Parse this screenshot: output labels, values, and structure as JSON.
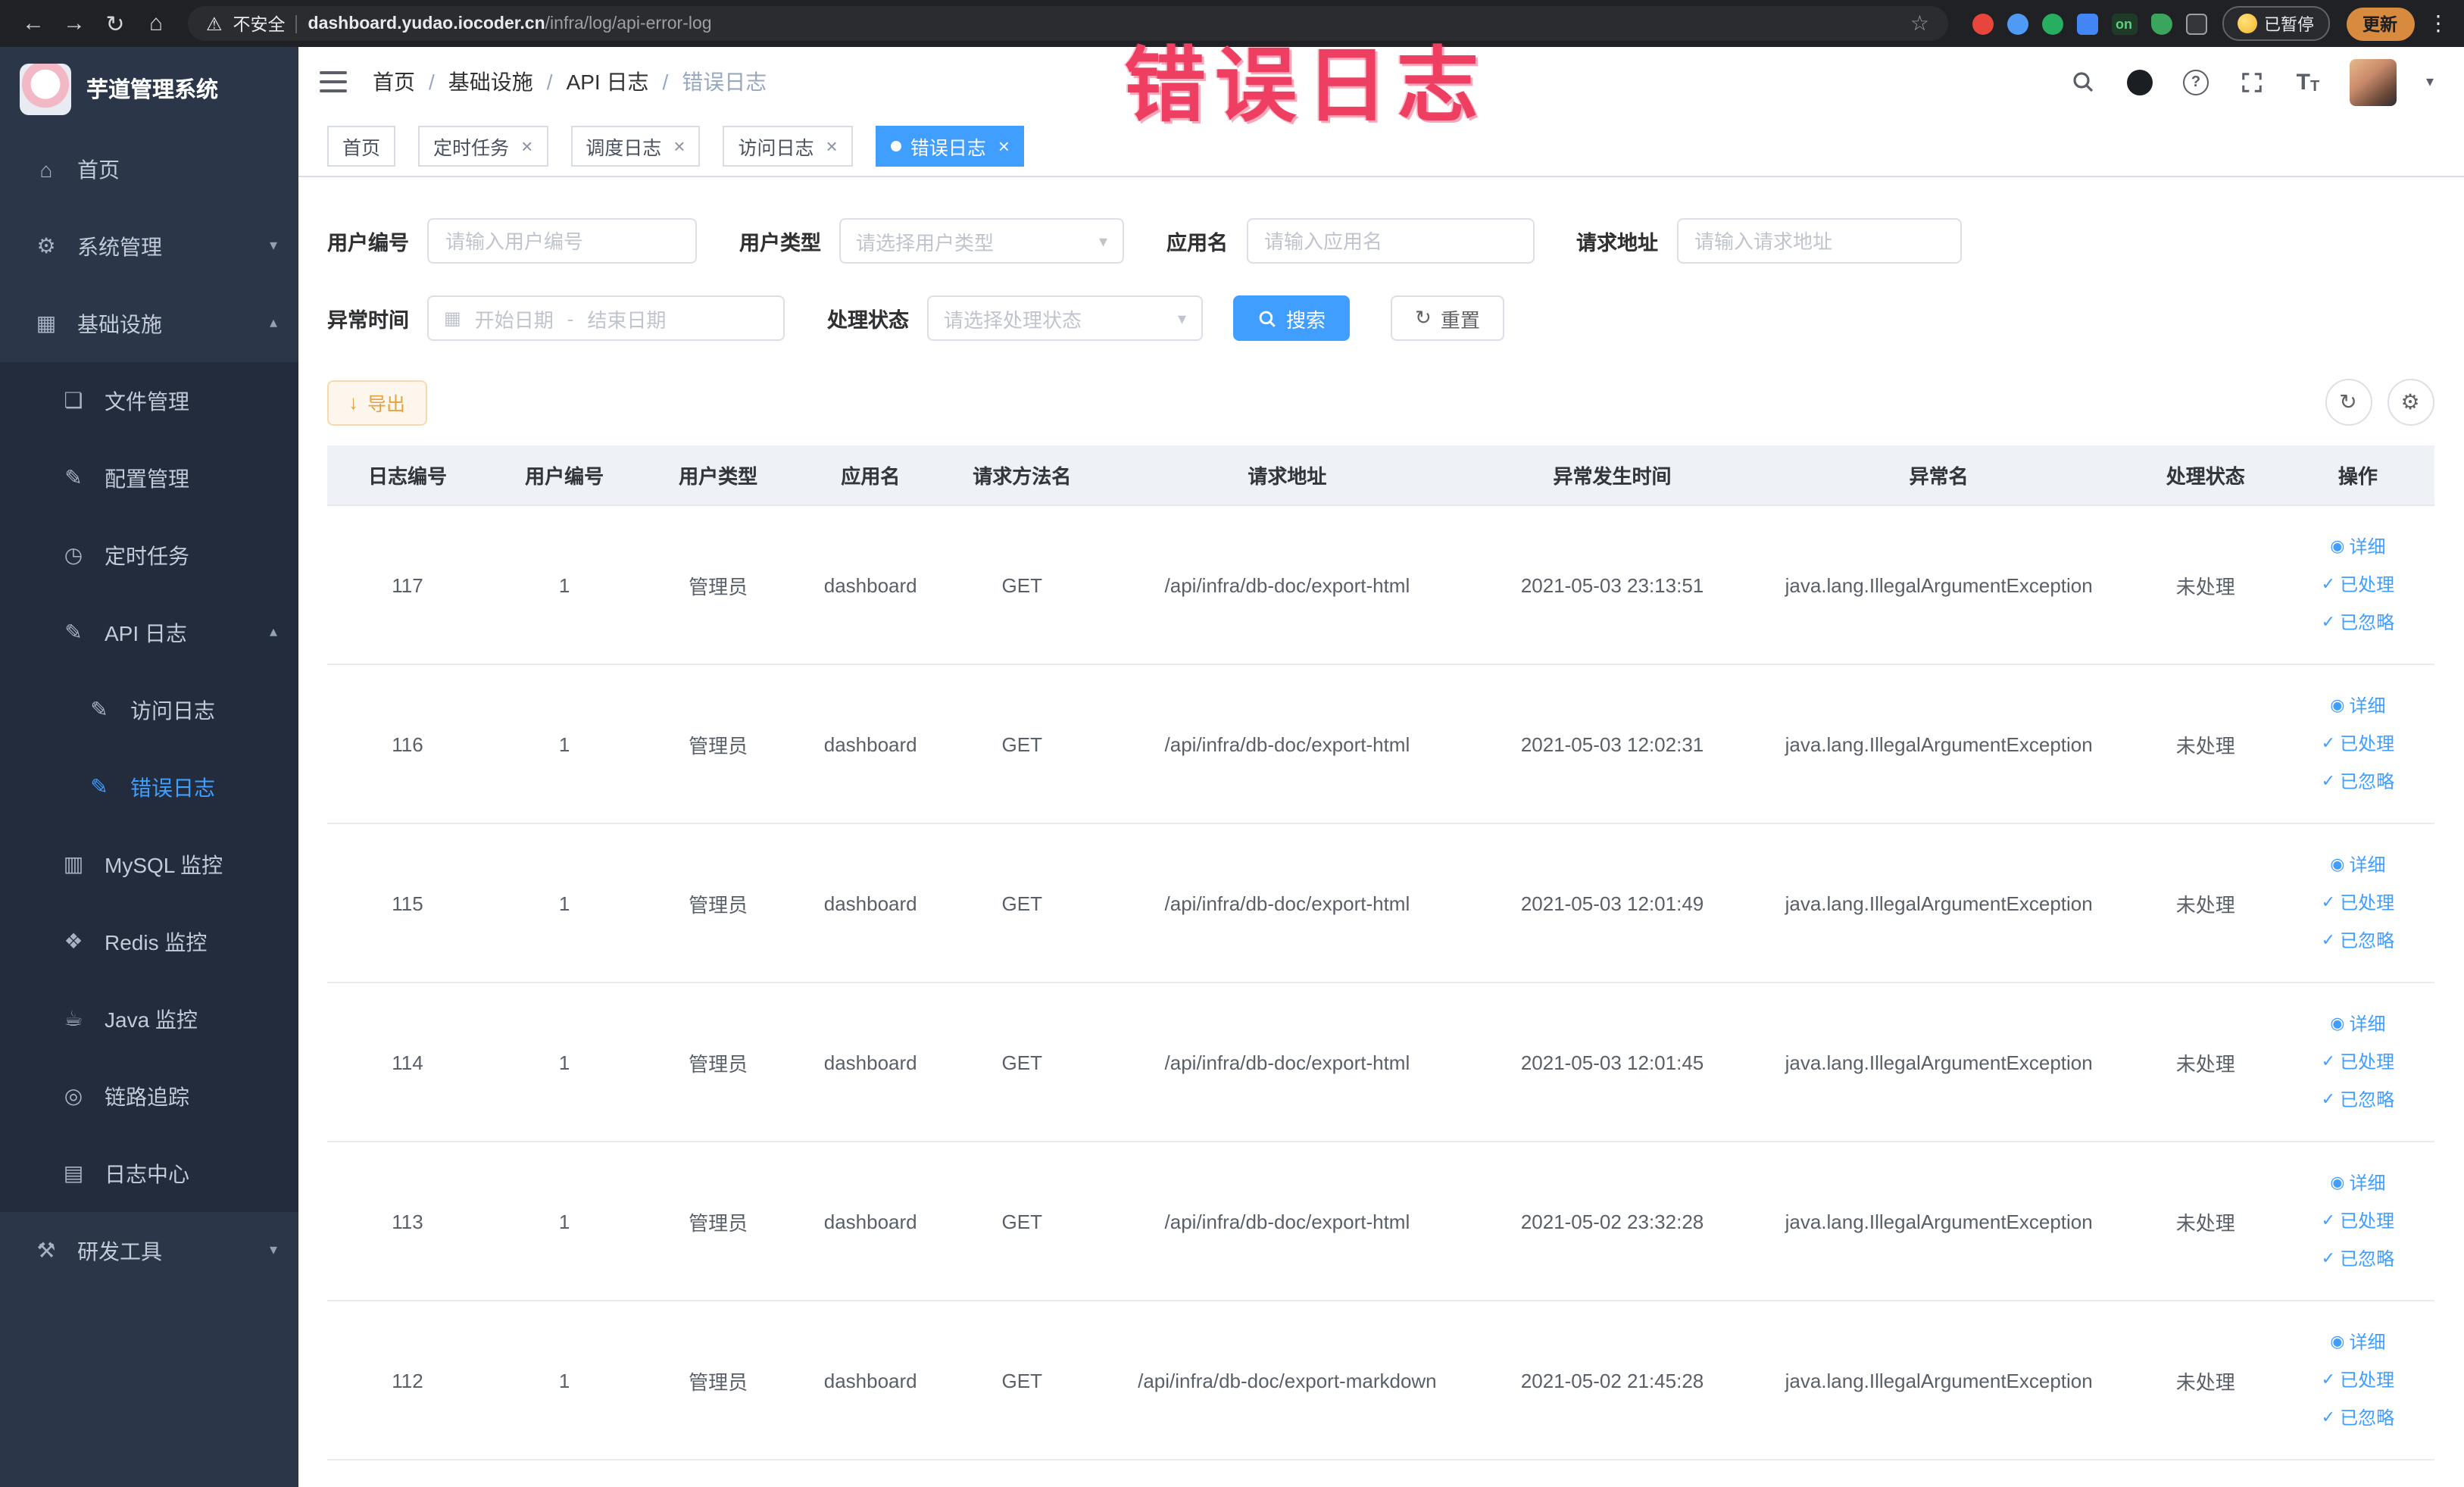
{
  "colors": {
    "primary": "#409eff",
    "annotation": "#ee3f63",
    "warning": "#e6a23c"
  },
  "browser": {
    "security_label": "不安全",
    "url_domain": "dashboard.yudao.iocoder.cn",
    "url_path": "/infra/log/api-error-log",
    "extension_on_badge": "on",
    "paused_label": "已暂停",
    "update_label": "更新"
  },
  "annotation": {
    "text": "错误日志"
  },
  "sidebar": {
    "title": "芋道管理系统",
    "items": [
      {
        "name": "home",
        "label": "首页",
        "icon": "home-icon",
        "level": 1
      },
      {
        "name": "system-management",
        "label": "系统管理",
        "icon": "gear-icon",
        "level": 1,
        "chevron": "down"
      },
      {
        "name": "infrastructure",
        "label": "基础设施",
        "icon": "grid-icon",
        "level": 1,
        "chevron": "up"
      },
      {
        "name": "file-management",
        "label": "文件管理",
        "icon": "folder-icon",
        "level": 2
      },
      {
        "name": "config-management",
        "label": "配置管理",
        "icon": "edit-icon",
        "level": 2
      },
      {
        "name": "scheduled-tasks",
        "label": "定时任务",
        "icon": "clock-icon",
        "level": 2
      },
      {
        "name": "api-log",
        "label": "API 日志",
        "icon": "edit-square-icon",
        "level": 2,
        "chevron": "up"
      },
      {
        "name": "access-log",
        "label": "访问日志",
        "icon": "edit-square-icon",
        "level": 3
      },
      {
        "name": "error-log",
        "label": "错误日志",
        "icon": "edit-square-icon",
        "level": 3,
        "active": true
      },
      {
        "name": "mysql-monitor",
        "label": "MySQL 监控",
        "icon": "monitor-icon",
        "level": 2
      },
      {
        "name": "redis-monitor",
        "label": "Redis 监控",
        "icon": "redis-icon",
        "level": 2
      },
      {
        "name": "java-monitor",
        "label": "Java 监控",
        "icon": "java-icon",
        "level": 2
      },
      {
        "name": "link-tracing",
        "label": "链路追踪",
        "icon": "trace-icon",
        "level": 2
      },
      {
        "name": "log-center",
        "label": "日志中心",
        "icon": "log-icon",
        "level": 2
      },
      {
        "name": "dev-tools",
        "label": "研发工具",
        "icon": "tools-icon",
        "level": 1,
        "chevron": "down"
      }
    ]
  },
  "header": {
    "breadcrumb": [
      "首页",
      "基础设施",
      "API 日志",
      "错误日志"
    ]
  },
  "tabs": [
    {
      "name": "home",
      "label": "首页",
      "closable": false,
      "active": false
    },
    {
      "name": "scheduled-tasks",
      "label": "定时任务",
      "closable": true,
      "active": false
    },
    {
      "name": "schedule-log",
      "label": "调度日志",
      "closable": true,
      "active": false
    },
    {
      "name": "access-log",
      "label": "访问日志",
      "closable": true,
      "active": false
    },
    {
      "name": "error-log",
      "label": "错误日志",
      "closable": true,
      "active": true
    }
  ],
  "filters": {
    "user_id": {
      "label": "用户编号",
      "placeholder": "请输入用户编号"
    },
    "user_type": {
      "label": "用户类型",
      "placeholder": "请选择用户类型"
    },
    "app_name": {
      "label": "应用名",
      "placeholder": "请输入应用名"
    },
    "request_url": {
      "label": "请求地址",
      "placeholder": "请输入请求地址"
    },
    "exception_time": {
      "label": "异常时间",
      "start_placeholder": "开始日期",
      "separator": "-",
      "end_placeholder": "结束日期"
    },
    "process_status": {
      "label": "处理状态",
      "placeholder": "请选择处理状态"
    },
    "search_button": "搜索",
    "reset_button": "重置"
  },
  "toolbar": {
    "export_button": "导出"
  },
  "table": {
    "columns": [
      {
        "label": "日志编号",
        "key": "log_id"
      },
      {
        "label": "用户编号",
        "key": "user_id"
      },
      {
        "label": "用户类型",
        "key": "user_type"
      },
      {
        "label": "应用名",
        "key": "app_name"
      },
      {
        "label": "请求方法名",
        "key": "method"
      },
      {
        "label": "请求地址",
        "key": "url"
      },
      {
        "label": "异常发生时间",
        "key": "time"
      },
      {
        "label": "异常名",
        "key": "exception"
      },
      {
        "label": "处理状态",
        "key": "status"
      },
      {
        "label": "操作",
        "key": "actions"
      }
    ],
    "row_actions": [
      {
        "name": "detail",
        "label": "详细",
        "icon": "view-icon"
      },
      {
        "name": "mark-processed",
        "label": "已处理",
        "icon": "check-icon"
      },
      {
        "name": "mark-ignored",
        "label": "已忽略",
        "icon": "check-icon"
      }
    ],
    "rows": [
      {
        "log_id": "117",
        "user_id": "1",
        "user_type": "管理员",
        "app_name": "dashboard",
        "method": "GET",
        "url": "/api/infra/db-doc/export-html",
        "time": "2021-05-03 23:13:51",
        "exception": "java.lang.IllegalArgumentException",
        "status": "未处理"
      },
      {
        "log_id": "116",
        "user_id": "1",
        "user_type": "管理员",
        "app_name": "dashboard",
        "method": "GET",
        "url": "/api/infra/db-doc/export-html",
        "time": "2021-05-03 12:02:31",
        "exception": "java.lang.IllegalArgumentException",
        "status": "未处理"
      },
      {
        "log_id": "115",
        "user_id": "1",
        "user_type": "管理员",
        "app_name": "dashboard",
        "method": "GET",
        "url": "/api/infra/db-doc/export-html",
        "time": "2021-05-03 12:01:49",
        "exception": "java.lang.IllegalArgumentException",
        "status": "未处理"
      },
      {
        "log_id": "114",
        "user_id": "1",
        "user_type": "管理员",
        "app_name": "dashboard",
        "method": "GET",
        "url": "/api/infra/db-doc/export-html",
        "time": "2021-05-03 12:01:45",
        "exception": "java.lang.IllegalArgumentException",
        "status": "未处理"
      },
      {
        "log_id": "113",
        "user_id": "1",
        "user_type": "管理员",
        "app_name": "dashboard",
        "method": "GET",
        "url": "/api/infra/db-doc/export-html",
        "time": "2021-05-02 23:32:28",
        "exception": "java.lang.IllegalArgumentException",
        "status": "未处理"
      },
      {
        "log_id": "112",
        "user_id": "1",
        "user_type": "管理员",
        "app_name": "dashboard",
        "method": "GET",
        "url": "/api/infra/db-doc/export-markdown",
        "time": "2021-05-02 21:45:28",
        "exception": "java.lang.IllegalArgumentException",
        "status": "未处理"
      }
    ]
  }
}
